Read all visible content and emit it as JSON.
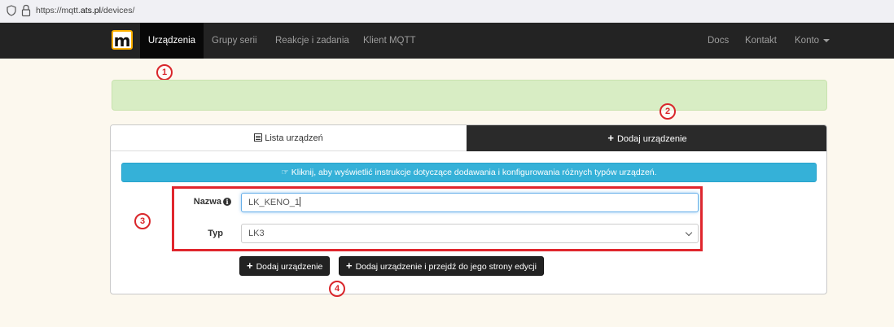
{
  "browser": {
    "url_prefix": "https://mqtt.",
    "url_domain": "ats.pl",
    "url_suffix": "/devices/"
  },
  "navbar": {
    "logo_letter": "m",
    "items": [
      {
        "label": "Urządzenia",
        "active": true
      },
      {
        "label": "Grupy serii"
      },
      {
        "label": "Reakcje i zadania"
      },
      {
        "label": "Klient MQTT"
      }
    ],
    "right_items": [
      {
        "label": "Docs"
      },
      {
        "label": "Kontakt"
      },
      {
        "label": "Konto"
      }
    ]
  },
  "annotations": [
    "1",
    "2",
    "3",
    "4"
  ],
  "tabs": {
    "list_label": "Lista urządzeń",
    "add_label": "Dodaj urządzenie"
  },
  "info_bar": {
    "text": "Kliknij, aby wyświetlić instrukcje dotyczące dodawania i konfigurowania różnych typów urządzeń."
  },
  "form": {
    "name_label": "Nazwa",
    "name_value": "LK_KENO_1",
    "type_label": "Typ",
    "type_value": "LK3"
  },
  "buttons": {
    "add": "Dodaj urządzenie",
    "add_and_edit": "Dodaj urządzenie i przejdź do jego strony edycji"
  },
  "colors": {
    "navbar_bg": "#232323",
    "alert_success": "#d8edc4",
    "info_bar": "#35b1d8",
    "annotation_red": "#d9262b",
    "page_bg": "#fcf8ee"
  }
}
